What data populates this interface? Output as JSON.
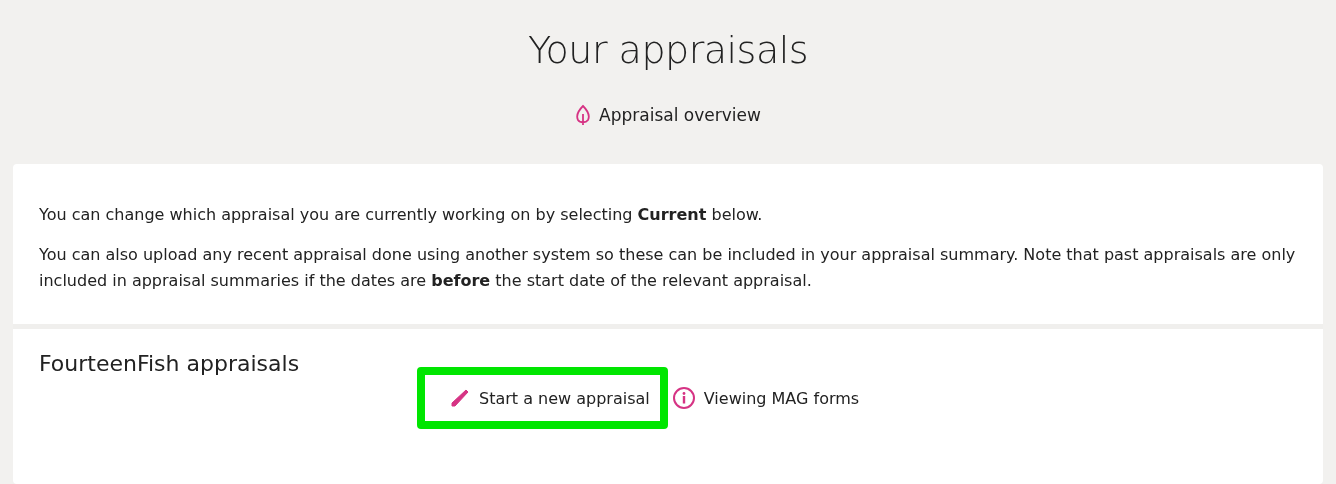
{
  "title": "Your appraisals",
  "overview_link": {
    "label": "Appraisal overview"
  },
  "intro": [
    "You can change which appraisal you are currently working on by selecting **Current** below.",
    "You can also upload any recent appraisal done using another system so these can be included in your appraisal summary. Note that past appraisals are only included in appraisal summaries if the dates are **before** the start date of the relevant appraisal."
  ],
  "section": {
    "heading": "FourteenFish appraisals",
    "actions": [
      {
        "label": "Start a new appraisal",
        "kind": "pencil",
        "highlighted": true
      },
      {
        "label": "Viewing MAG forms",
        "kind": "info",
        "highlighted": false
      }
    ]
  }
}
